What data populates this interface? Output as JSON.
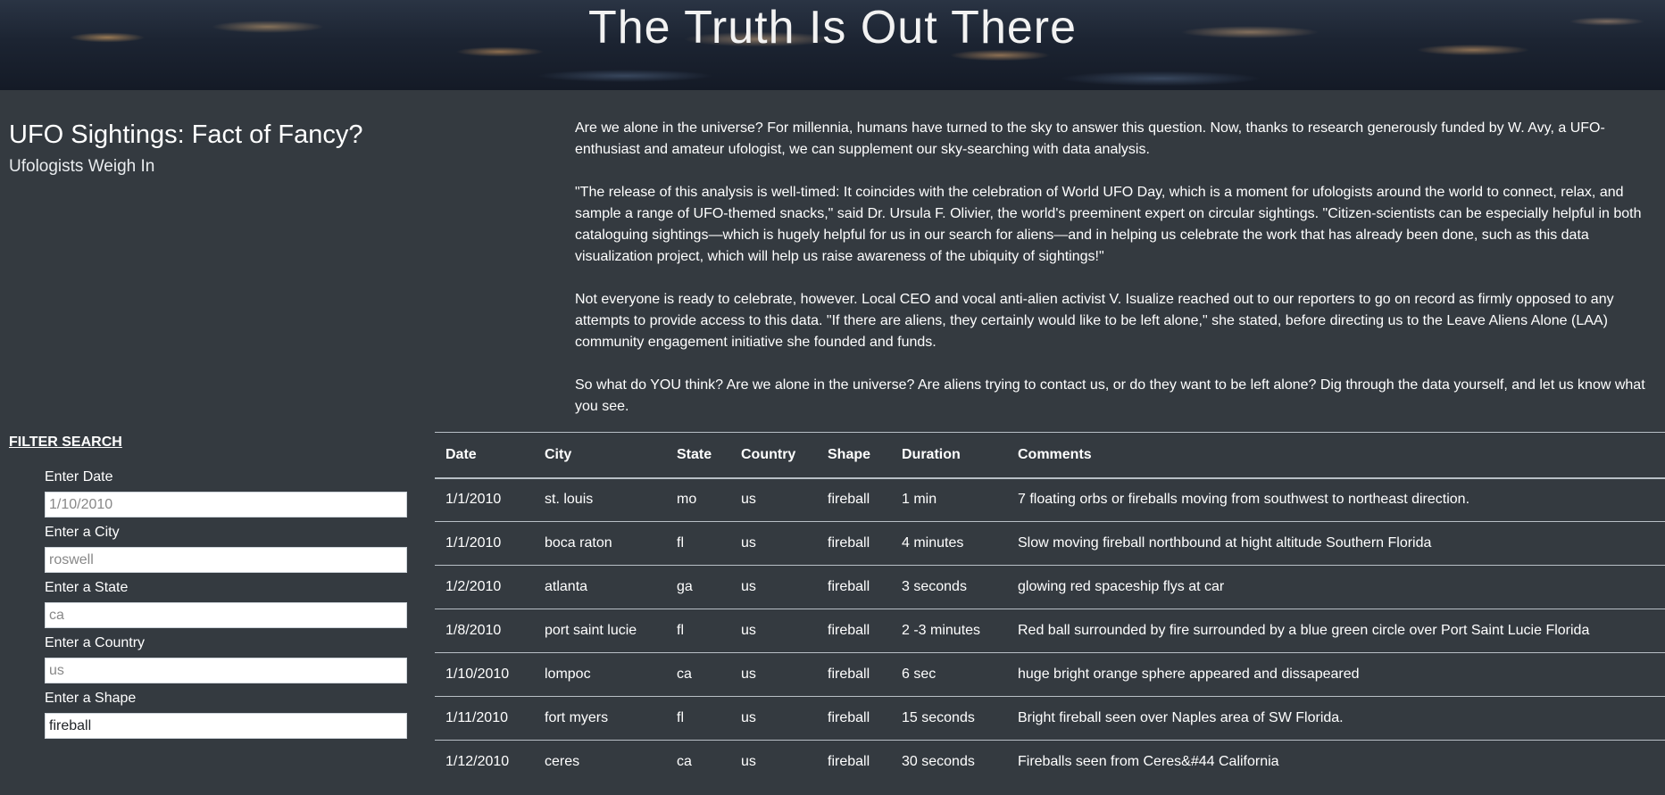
{
  "hero": {
    "title": "The Truth Is Out There"
  },
  "intro": {
    "headline": "UFO Sightings: Fact of Fancy?",
    "subheadline": "Ufologists Weigh In"
  },
  "article": {
    "paragraphs": [
      "Are we alone in the universe? For millennia, humans have turned to the sky to answer this question. Now, thanks to research generously funded by W. Avy, a UFO-enthusiast and amateur ufologist, we can supplement our sky-searching with data analysis.",
      "\"The release of this analysis is well-timed: It coincides with the celebration of World UFO Day, which is a moment for ufologists around the world to connect, relax, and sample a range of UFO-themed snacks,\" said Dr. Ursula F. Olivier, the world's preeminent expert on circular sightings. \"Citizen-scientists can be especially helpful in both cataloguing sightings—which is hugely helpful for us in our search for aliens—and in helping us celebrate the work that has already been done, such as this data visualization project, which will help us raise awareness of the ubiquity of sightings!\"",
      "Not everyone is ready to celebrate, however. Local CEO and vocal anti-alien activist V. Isualize reached out to our reporters to go on record as firmly opposed to any attempts to provide access to this data. \"If there are aliens, they certainly would like to be left alone,\" she stated, before directing us to the Leave Aliens Alone (LAA) community engagement initiative she founded and funds.",
      "So what do YOU think? Are we alone in the universe? Are aliens trying to contact us, or do they want to be left alone? Dig through the data yourself, and let us know what you see."
    ]
  },
  "filters": {
    "title": "FILTER SEARCH",
    "fields": [
      {
        "label": "Enter Date",
        "placeholder": "1/10/2010",
        "value": ""
      },
      {
        "label": "Enter a City",
        "placeholder": "roswell",
        "value": ""
      },
      {
        "label": "Enter a State",
        "placeholder": "ca",
        "value": ""
      },
      {
        "label": "Enter a Country",
        "placeholder": "us",
        "value": ""
      },
      {
        "label": "Enter a Shape",
        "placeholder": "",
        "value": "fireball"
      }
    ]
  },
  "table": {
    "headers": [
      "Date",
      "City",
      "State",
      "Country",
      "Shape",
      "Duration",
      "Comments"
    ],
    "rows": [
      [
        "1/1/2010",
        "st. louis",
        "mo",
        "us",
        "fireball",
        "1 min",
        "7 floating orbs or fireballs moving from southwest to northeast direction."
      ],
      [
        "1/1/2010",
        "boca raton",
        "fl",
        "us",
        "fireball",
        "4 minutes",
        "Slow moving fireball northbound at hight altitude Southern Florida"
      ],
      [
        "1/2/2010",
        "atlanta",
        "ga",
        "us",
        "fireball",
        "3 seconds",
        "glowing red spaceship flys at car"
      ],
      [
        "1/8/2010",
        "port saint lucie",
        "fl",
        "us",
        "fireball",
        "2 -3 minutes",
        "Red ball surrounded by fire surrounded by a blue green circle over Port Saint Lucie Florida"
      ],
      [
        "1/10/2010",
        "lompoc",
        "ca",
        "us",
        "fireball",
        "6 sec",
        "huge bright orange sphere appeared and dissapeared"
      ],
      [
        "1/11/2010",
        "fort myers",
        "fl",
        "us",
        "fireball",
        "15 seconds",
        "Bright fireball seen over Naples area of SW Florida."
      ],
      [
        "1/12/2010",
        "ceres",
        "ca",
        "us",
        "fireball",
        "30 seconds",
        "Fireballs seen from Ceres&#44 California"
      ]
    ]
  }
}
